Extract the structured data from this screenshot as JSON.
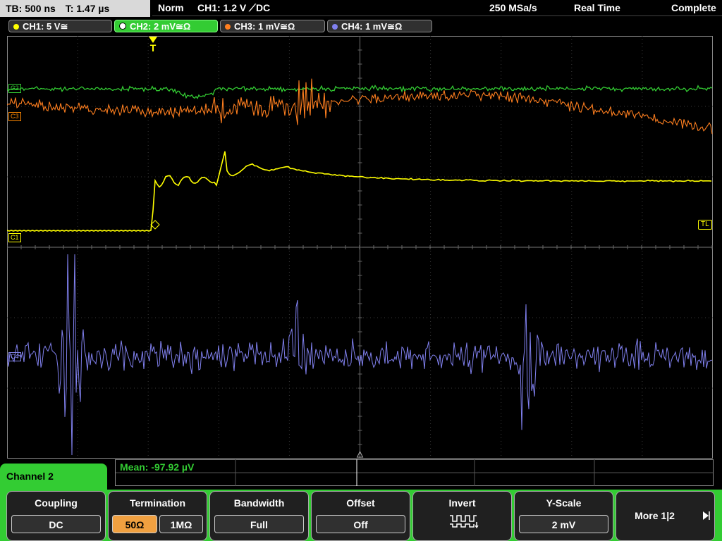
{
  "status": {
    "timebase": "TB: 500 ns",
    "trigger_time": "T: 1.47 µs",
    "trigger_mode": "Norm",
    "trigger_setting": "CH1: 1.2 V ⟋DC",
    "sample_rate": "250 MSa/s",
    "acq_mode": "Real Time",
    "acq_state": "Complete"
  },
  "channels": [
    {
      "label": "CH1: 5 V≅",
      "color": "#ffff00"
    },
    {
      "label": "CH2: 2 mV≅Ω",
      "color": "#33cc33"
    },
    {
      "label": "CH3: 1 mV≅Ω",
      "color": "#ff7f1f"
    },
    {
      "label": "CH4: 1 mV≅Ω",
      "color": "#8080ee"
    }
  ],
  "markers": {
    "trigger": "T",
    "trigger_level": "TL",
    "ch1": "C1",
    "ch2": "C2",
    "ch3": "C3",
    "ch4": "C4"
  },
  "measurement": {
    "label": "Mean: -97.92 µV"
  },
  "menu": {
    "title": "Channel 2",
    "softkeys": [
      {
        "header": "Coupling",
        "value": "DC"
      },
      {
        "header": "Termination",
        "options": [
          "50Ω",
          "1MΩ"
        ],
        "selected": "50Ω"
      },
      {
        "header": "Bandwidth",
        "value": "Full"
      },
      {
        "header": "Offset",
        "value": "Off"
      },
      {
        "header": "Invert",
        "icon": "invert-pulse-icon"
      },
      {
        "header": "Y-Scale",
        "value": "2 mV"
      },
      {
        "header": "More 1|2",
        "icon": "play-arrow-icon"
      }
    ]
  }
}
